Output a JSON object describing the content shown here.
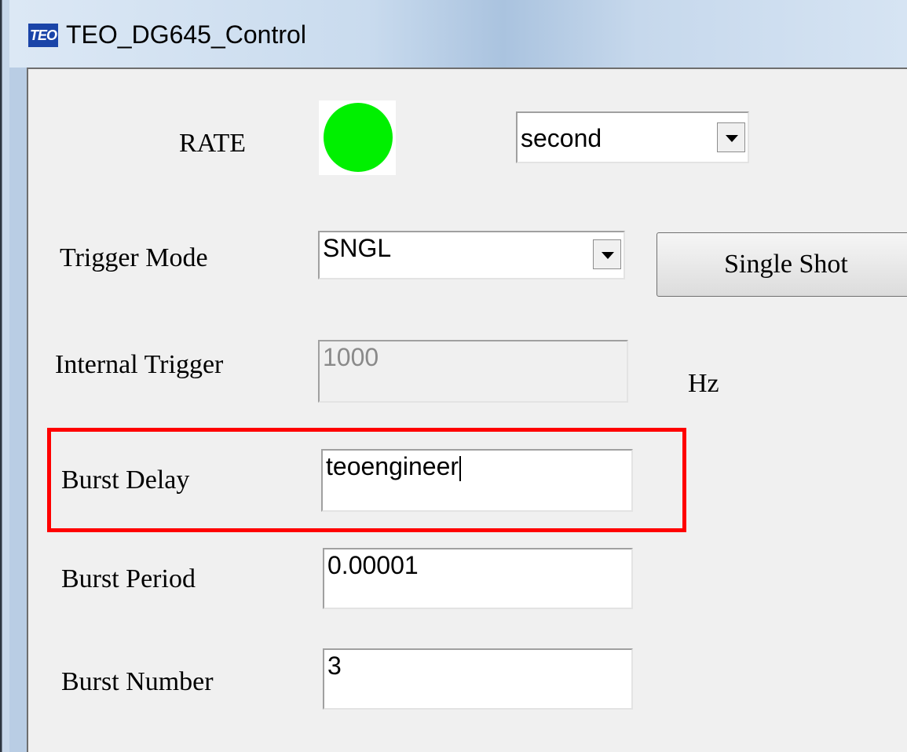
{
  "window": {
    "title": "TEO_DG645_Control",
    "icon_text": "TEO"
  },
  "rate": {
    "label": "RATE",
    "indicator_color": "#00f000",
    "unit_select": "second"
  },
  "trigger_mode": {
    "label": "Trigger Mode",
    "value": "SNGL",
    "single_shot_button": "Single Shot"
  },
  "internal_trigger": {
    "label": "Internal Trigger",
    "value": "1000",
    "unit": "Hz",
    "enabled": false
  },
  "burst_delay": {
    "label": "Burst Delay",
    "value": "teoengineer",
    "highlight_color": "#ff0000"
  },
  "burst_period": {
    "label": "Burst Period",
    "value": "0.00001"
  },
  "burst_number": {
    "label": "Burst Number",
    "value": "3"
  }
}
